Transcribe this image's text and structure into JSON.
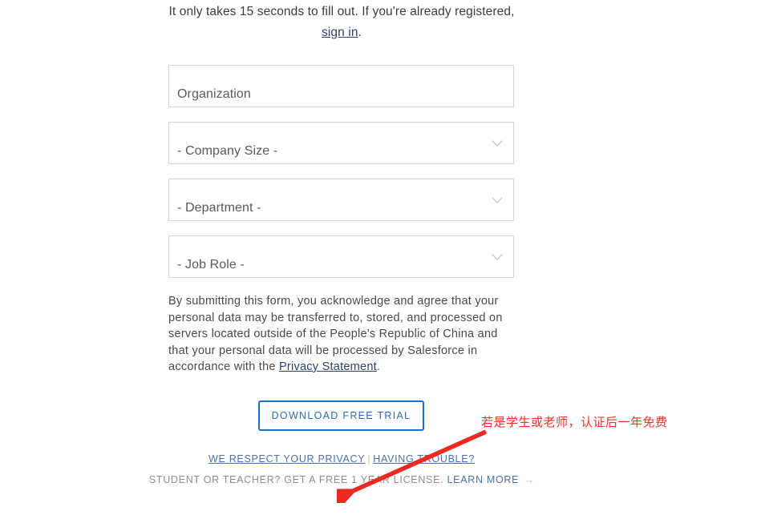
{
  "intro": {
    "text_before": "It only takes 15 seconds to fill out. If you're already registered, ",
    "link_label": "sign in",
    "text_after": "."
  },
  "form": {
    "fields": [
      {
        "name": "organization",
        "value": "Organization",
        "type": "text",
        "has_chevron": false
      },
      {
        "name": "company-size",
        "value": "- Company Size -",
        "type": "select",
        "has_chevron": true
      },
      {
        "name": "department",
        "value": "- Department -",
        "type": "select",
        "has_chevron": true
      },
      {
        "name": "job-role",
        "value": "- Job Role -",
        "type": "select",
        "has_chevron": true
      }
    ],
    "chevron_icon": "chevron-down-icon"
  },
  "legal": {
    "text_before": "By submitting this form, you acknowledge and agree that your personal data may be transferred to, stored, and processed on servers located outside of the People's Republic of China and that your personal data will be processed by Salesforce in accordance with the ",
    "link_label": "Privacy Statement",
    "text_after": "."
  },
  "cta": {
    "label": "DOWNLOAD FREE TRIAL",
    "border_color": "#1b6ec2",
    "text_color": "#2b6cb5"
  },
  "footer": {
    "privacy_link": "WE RESPECT YOUR PRIVACY",
    "separator": "|",
    "trouble_link": "HAVING TROUBLE?",
    "student_text": "STUDENT OR TEACHER? GET A FREE 1 YEAR LICENSE. ",
    "learn_more_link": "LEARN MORE",
    "arrow_glyph": "→",
    "link_color": "#4a72a8"
  },
  "annotation": {
    "text": "若是学生或老师，认证后一年免费",
    "color": "#e8332a",
    "arrow_name": "red-annotation-arrow"
  }
}
